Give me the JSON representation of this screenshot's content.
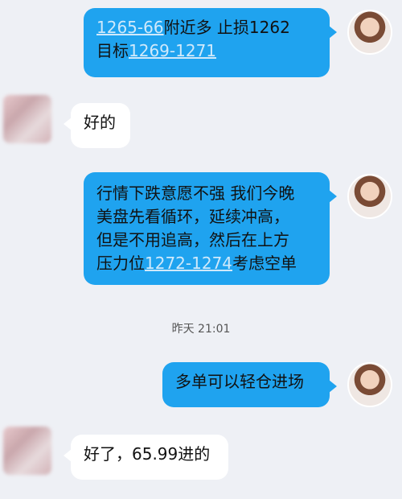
{
  "messages": [
    {
      "direction": "outgoing",
      "lines": [
        [
          {
            "text": "1265-66",
            "link": true
          },
          {
            "text": "附近多 止损1262",
            "link": false
          }
        ],
        [
          {
            "text": "目标",
            "link": false
          },
          {
            "text": "1269-1271",
            "link": true
          }
        ]
      ]
    },
    {
      "direction": "incoming",
      "text": "好的"
    },
    {
      "direction": "outgoing",
      "lines": [
        [
          {
            "text": "行情下跌意愿不强 我们今晚",
            "link": false
          }
        ],
        [
          {
            "text": "美盘先看循环，延续冲高，",
            "link": false
          }
        ],
        [
          {
            "text": "但是不用追高，然后在上方",
            "link": false
          }
        ],
        [
          {
            "text": "压力位",
            "link": false
          },
          {
            "text": "1272-1274",
            "link": true
          },
          {
            "text": "考虑空单",
            "link": false
          }
        ]
      ]
    },
    {
      "type": "timestamp",
      "text": "昨天 21:01"
    },
    {
      "direction": "outgoing",
      "text": "多单可以轻仓进场"
    },
    {
      "direction": "incoming",
      "text": "好了，65.99进的"
    }
  ],
  "colors": {
    "background": "#eef0f5",
    "outgoing_bubble": "#1fa3ef",
    "incoming_bubble": "#ffffff",
    "link_text": "#cfe9fb"
  }
}
